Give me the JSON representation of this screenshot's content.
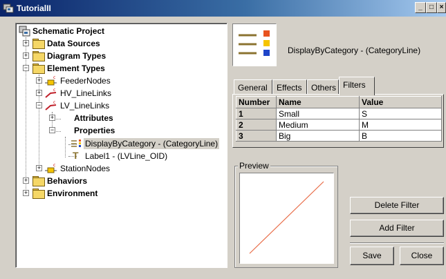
{
  "window": {
    "title": "TutorialII",
    "minimize": "_",
    "maximize": "□",
    "close": "×"
  },
  "tree": {
    "root": "Schematic Project",
    "data_sources": "Data Sources",
    "diagram_types": "Diagram Types",
    "element_types": "Element Types",
    "feeder_nodes": "FeederNodes",
    "hv_linelinks": "HV_LineLinks",
    "lv_linelinks": "LV_LineLinks",
    "attributes": "Attributes",
    "properties": "Properties",
    "display_by_category": "DisplayByCategory - (CategoryLine)",
    "label1": "Label1 - (LVLine_OID)",
    "station_nodes": "StationNodes",
    "behaviors": "Behaviors",
    "environment": "Environment",
    "expanded_symbol": "−",
    "collapsed_symbol": "+"
  },
  "header": {
    "title": "DisplayByCategory - (CategoryLine)",
    "icon_colors": [
      "#e8531f",
      "#f5c400",
      "#1f45c9"
    ],
    "line_color": "#8b7330"
  },
  "tabs": [
    "General",
    "Effects",
    "Others",
    "Filters"
  ],
  "active_tab": "Filters",
  "filters_table": {
    "columns": [
      "Number",
      "Name",
      "Value"
    ],
    "rows": [
      {
        "number": "1",
        "name": "Small",
        "value": "S"
      },
      {
        "number": "2",
        "name": "Medium",
        "value": "M"
      },
      {
        "number": "3",
        "name": "Big",
        "value": "B"
      }
    ]
  },
  "preview": {
    "label": "Preview",
    "line_color": "#e86a45"
  },
  "buttons": {
    "delete_filter": "Delete Filter",
    "add_filter": "Add Filter",
    "save": "Save",
    "close": "Close"
  }
}
